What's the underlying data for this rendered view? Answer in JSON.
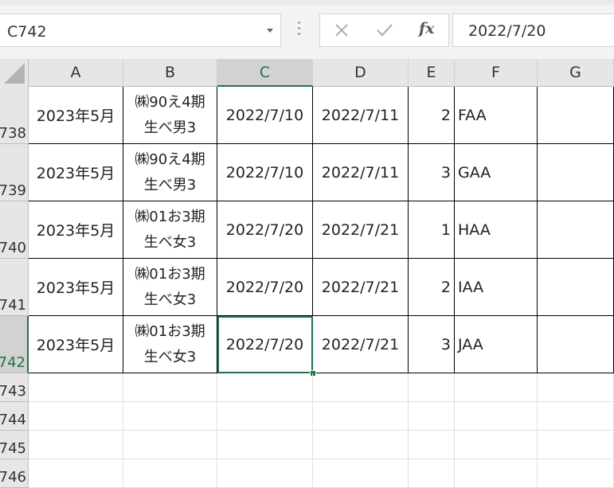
{
  "namebox": {
    "value": "C742"
  },
  "formula_bar": {
    "cancel_icon": "close-icon",
    "enter_icon": "check-icon",
    "fx_label": "fx",
    "value": "2022/7/20"
  },
  "columns": [
    "A",
    "B",
    "C",
    "D",
    "E",
    "F",
    "G"
  ],
  "active_column": "C",
  "active_row": "742",
  "rows": [
    {
      "number": "738",
      "A": "2023年5月",
      "B1": "㈱90え4期",
      "B2": "生べ男3",
      "C": "2022/7/10",
      "D": "2022/7/11",
      "E": "2",
      "F": "FAA",
      "G": ""
    },
    {
      "number": "739",
      "A": "2023年5月",
      "B1": "㈱90え4期",
      "B2": "生べ男3",
      "C": "2022/7/10",
      "D": "2022/7/11",
      "E": "3",
      "F": "GAA",
      "G": ""
    },
    {
      "number": "740",
      "A": "2023年5月",
      "B1": "㈱01お3期",
      "B2": "生べ女3",
      "C": "2022/7/20",
      "D": "2022/7/21",
      "E": "1",
      "F": "HAA",
      "G": ""
    },
    {
      "number": "741",
      "A": "2023年5月",
      "B1": "㈱01お3期",
      "B2": "生べ女3",
      "C": "2022/7/20",
      "D": "2022/7/21",
      "E": "2",
      "F": "IAA",
      "G": ""
    },
    {
      "number": "742",
      "A": "2023年5月",
      "B1": "㈱01お3期",
      "B2": "生べ女3",
      "C": "2022/7/20",
      "D": "2022/7/21",
      "E": "3",
      "F": "JAA",
      "G": ""
    }
  ],
  "empty_rows": [
    "743",
    "744",
    "745",
    "746"
  ],
  "colors": {
    "selection": "#217346",
    "header_bg": "#e6e6e6"
  }
}
